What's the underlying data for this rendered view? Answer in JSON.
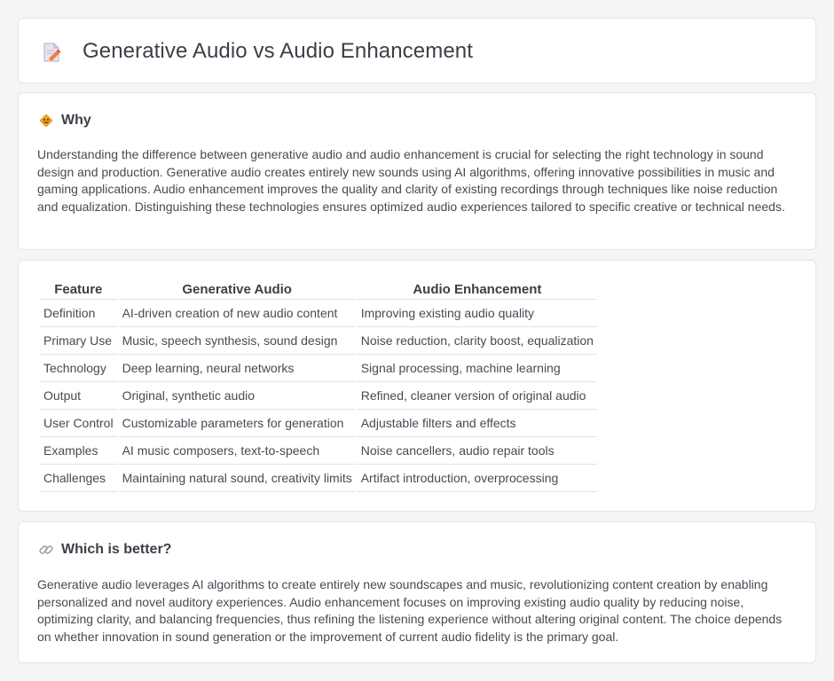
{
  "header": {
    "title": "Generative Audio vs Audio Enhancement",
    "icon": "document-pencil-icon"
  },
  "why": {
    "title": "Why",
    "icon": "diamond-sign-icon",
    "body": "Understanding the difference between generative audio and audio enhancement is crucial for selecting the right technology in sound design and production. Generative audio creates entirely new sounds using AI algorithms, offering innovative possibilities in music and gaming applications. Audio enhancement improves the quality and clarity of existing recordings through techniques like noise reduction and equalization. Distinguishing these technologies ensures optimized audio experiences tailored to specific creative or technical needs."
  },
  "comparison": {
    "headers": [
      "Feature",
      "Generative Audio",
      "Audio Enhancement"
    ],
    "rows": [
      [
        "Definition",
        "AI-driven creation of new audio content",
        "Improving existing audio quality"
      ],
      [
        "Primary Use",
        "Music, speech synthesis, sound design",
        "Noise reduction, clarity boost, equalization"
      ],
      [
        "Technology",
        "Deep learning, neural networks",
        "Signal processing, machine learning"
      ],
      [
        "Output",
        "Original, synthetic audio",
        "Refined, cleaner version of original audio"
      ],
      [
        "User Control",
        "Customizable parameters for generation",
        "Adjustable filters and effects"
      ],
      [
        "Examples",
        "AI music composers, text-to-speech",
        "Noise cancellers, audio repair tools"
      ],
      [
        "Challenges",
        "Maintaining natural sound, creativity limits",
        "Artifact introduction, overprocessing"
      ]
    ]
  },
  "better": {
    "title": "Which is better?",
    "icon": "link-icon",
    "body": "Generative audio leverages AI algorithms to create entirely new soundscapes and music, revolutionizing content creation by enabling personalized and novel auditory experiences. Audio enhancement focuses on improving existing audio quality by reducing noise, optimizing clarity, and balancing frequencies, thus refining the listening experience without altering original content. The choice depends on whether innovation in sound generation or the improvement of current audio fidelity is the primary goal."
  },
  "colors": {
    "background": "#f4f5f7",
    "card": "#ffffff",
    "border": "#e2e5ea",
    "accent_orange": "#f0a030"
  }
}
